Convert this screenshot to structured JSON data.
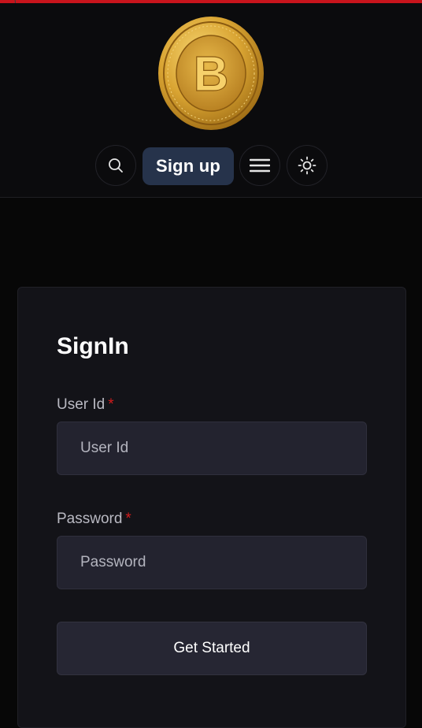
{
  "header": {
    "logo_icon": "bitcoin-gold-coin",
    "logo_letter": "B",
    "nav": {
      "search_icon": "search-icon",
      "signup_label": "Sign up",
      "menu_icon": "hamburger-menu-icon",
      "theme_icon": "sun-icon"
    }
  },
  "signin": {
    "title": "SignIn",
    "user_id": {
      "label": "User Id",
      "required_mark": "*",
      "placeholder": "User Id",
      "value": ""
    },
    "password": {
      "label": "Password",
      "required_mark": "*",
      "placeholder": "Password",
      "value": ""
    },
    "submit_label": "Get Started"
  },
  "colors": {
    "accent_bar": "#c8141c",
    "signup_bg": "#26334b",
    "required": "#d21c1c",
    "card_bg": "#131318",
    "input_bg": "#23232f"
  }
}
